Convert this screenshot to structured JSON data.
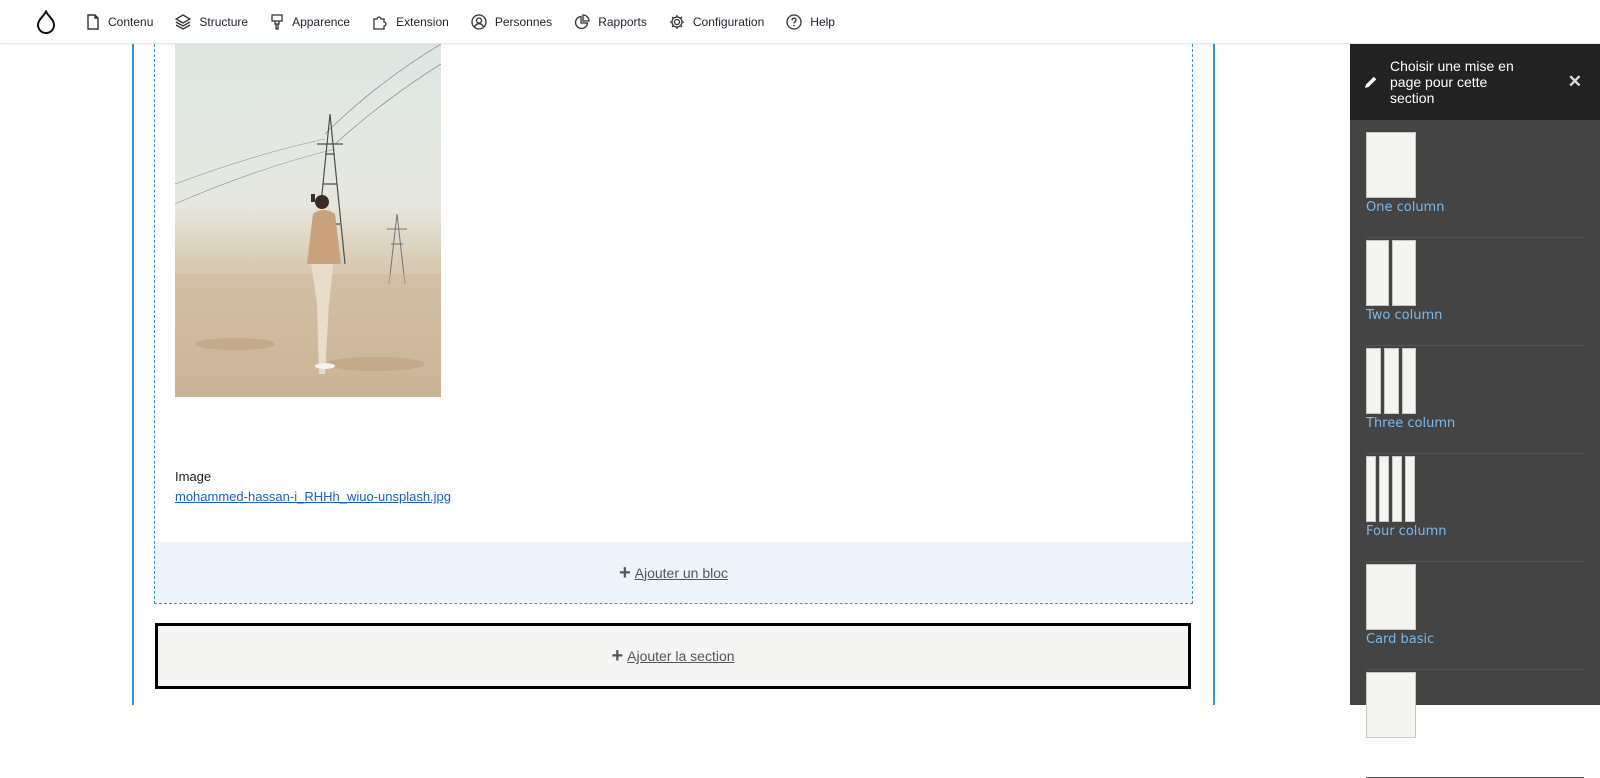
{
  "toolbar": {
    "logo_icon": "drupal-drop-icon",
    "items": [
      {
        "label": "Contenu",
        "icon": "page-icon"
      },
      {
        "label": "Structure",
        "icon": "layers-icon"
      },
      {
        "label": "Apparence",
        "icon": "paintbrush-icon"
      },
      {
        "label": "Extension",
        "icon": "puzzle-icon"
      },
      {
        "label": "Personnes",
        "icon": "person-icon"
      },
      {
        "label": "Rapports",
        "icon": "pie-chart-icon"
      },
      {
        "label": "Configuration",
        "icon": "gear-icon"
      },
      {
        "label": "Help",
        "icon": "question-icon"
      }
    ]
  },
  "content": {
    "image_label": "Image",
    "image_file_link": "mohammed-hassan-i_RHHh_wiuo-unsplash.jpg",
    "add_block_label": "Ajouter un bloc",
    "add_section_label": "Ajouter la section",
    "plus_glyph": "+"
  },
  "sidebar": {
    "title": "Choisir une mise en page pour cette section",
    "close_glyph": "✕",
    "layouts": [
      {
        "label": "One column",
        "columns": 1
      },
      {
        "label": "Two column",
        "columns": 2
      },
      {
        "label": "Three column",
        "columns": 3
      },
      {
        "label": "Four column",
        "columns": 4
      },
      {
        "label": "Card basic",
        "columns": 1
      },
      {
        "label": "",
        "columns": 1
      }
    ]
  },
  "colors": {
    "accent_blue": "#3b8fd4",
    "link_blue": "#1a5fc1",
    "sidebar_bg": "#444444",
    "sidebar_header_bg": "#222222",
    "layout_label": "#7cb8ea"
  }
}
